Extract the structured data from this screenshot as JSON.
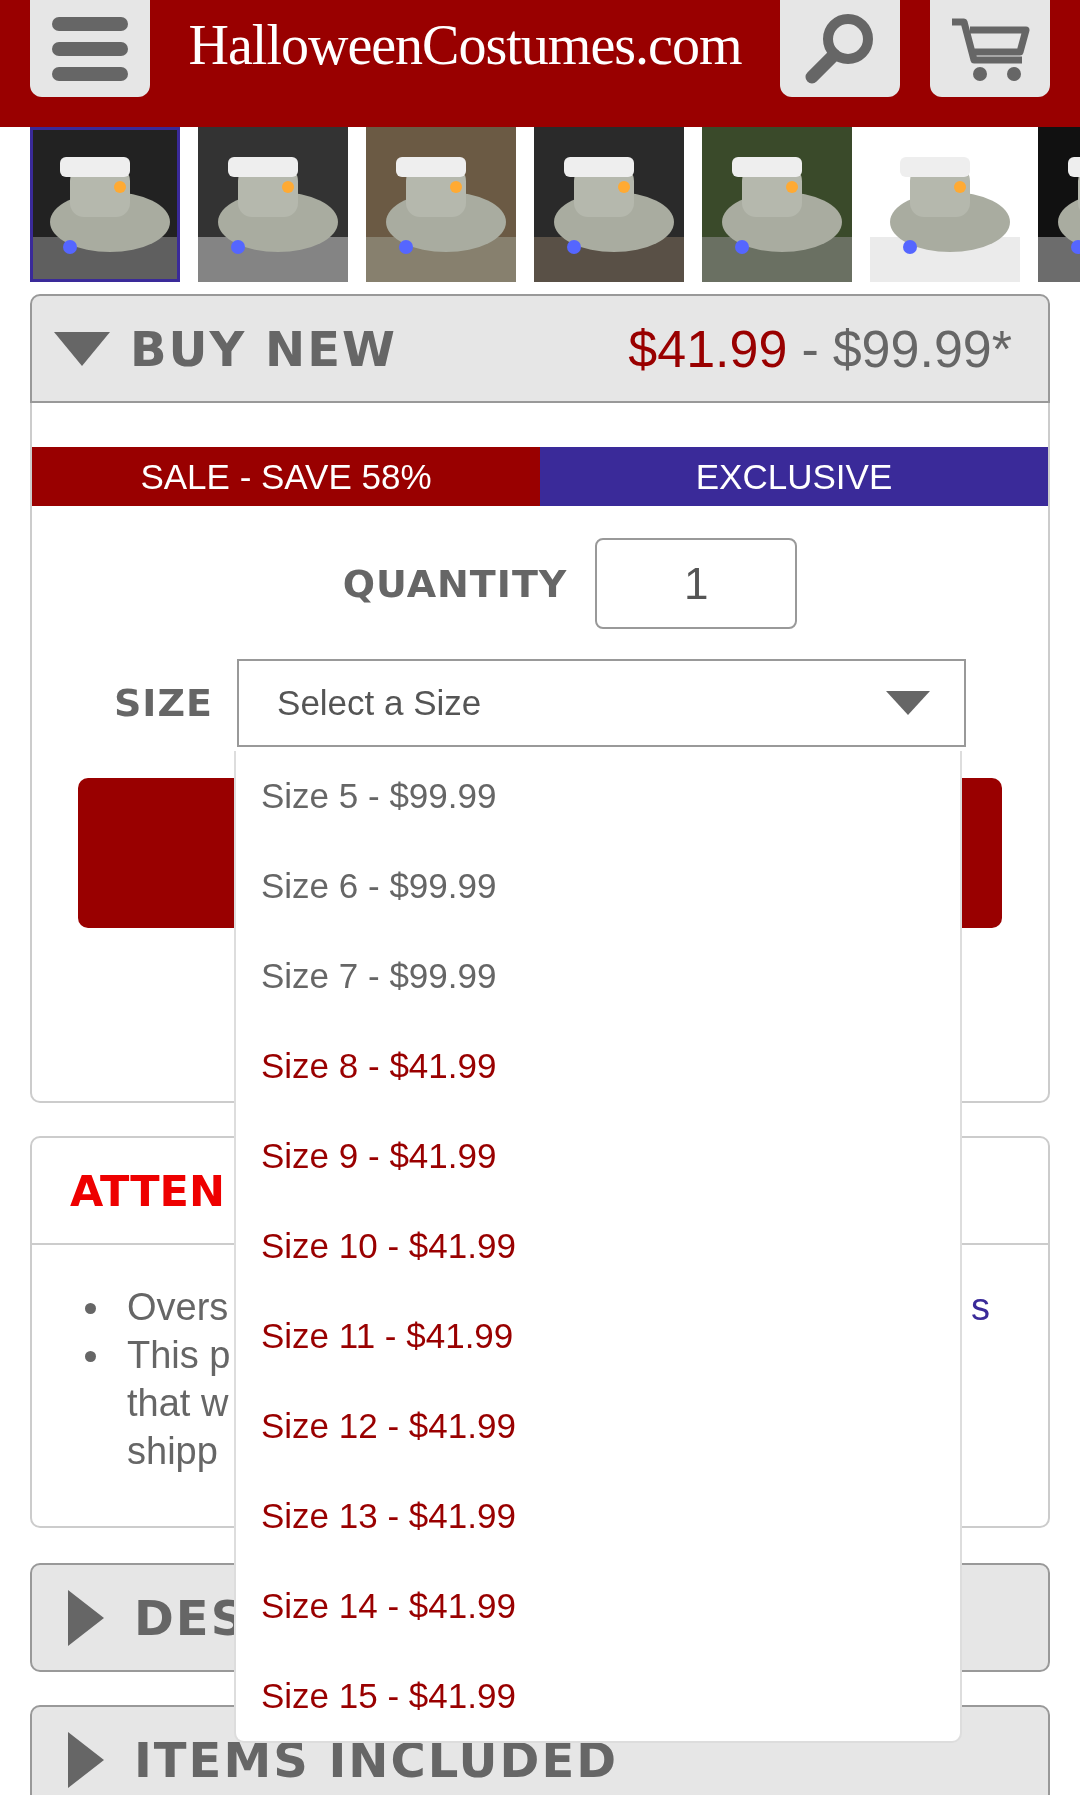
{
  "header": {
    "logo": "HalloweenCostumes.com"
  },
  "thumbnails": [
    {
      "kind": "picture",
      "selected": true
    },
    {
      "kind": "picture",
      "selected": false
    },
    {
      "kind": "picture",
      "selected": false
    },
    {
      "kind": "picture",
      "selected": false
    },
    {
      "kind": "picture",
      "selected": false
    },
    {
      "kind": "picture",
      "selected": false
    },
    {
      "kind": "picture",
      "selected": false
    }
  ],
  "buy_panel": {
    "title": "BUY NEW",
    "expanded": true,
    "price_low": "$41.99",
    "price_separator": "-",
    "price_high": "$99.99*",
    "badges": [
      {
        "label": "SALE - SAVE 58%",
        "color": "#990000"
      },
      {
        "label": "EXCLUSIVE",
        "color": "#3a2a99"
      }
    ],
    "quantity_label": "QUANTITY",
    "quantity": "1",
    "size_label": "SIZE",
    "size_select": {
      "value": "Select a Size",
      "expanded": true,
      "options": [
        {
          "label": "Size 5 - $99.99",
          "sale": false
        },
        {
          "label": "Size 6 - $99.99",
          "sale": false
        },
        {
          "label": "Size 7 - $99.99",
          "sale": false
        },
        {
          "label": "Size 8 - $41.99",
          "sale": true
        },
        {
          "label": "Size 9 - $41.99",
          "sale": true
        },
        {
          "label": "Size 10 - $41.99",
          "sale": true
        },
        {
          "label": "Size 11 - $41.99",
          "sale": true
        },
        {
          "label": "Size 12 - $41.99",
          "sale": true
        },
        {
          "label": "Size 13 - $41.99",
          "sale": true
        },
        {
          "label": "Size 14 - $41.99",
          "sale": true
        },
        {
          "label": "Size 15 - $41.99",
          "sale": true
        }
      ]
    }
  },
  "attention": {
    "title": "ATTEN",
    "bullets": [
      {
        "text": "Overs",
        "link": "s"
      },
      {
        "text": "This p\nthat w\nshipp"
      }
    ]
  },
  "sections": [
    {
      "title": "DES",
      "expanded": false
    },
    {
      "title": "ITEMS INCLUDED",
      "expanded": false
    }
  ]
}
